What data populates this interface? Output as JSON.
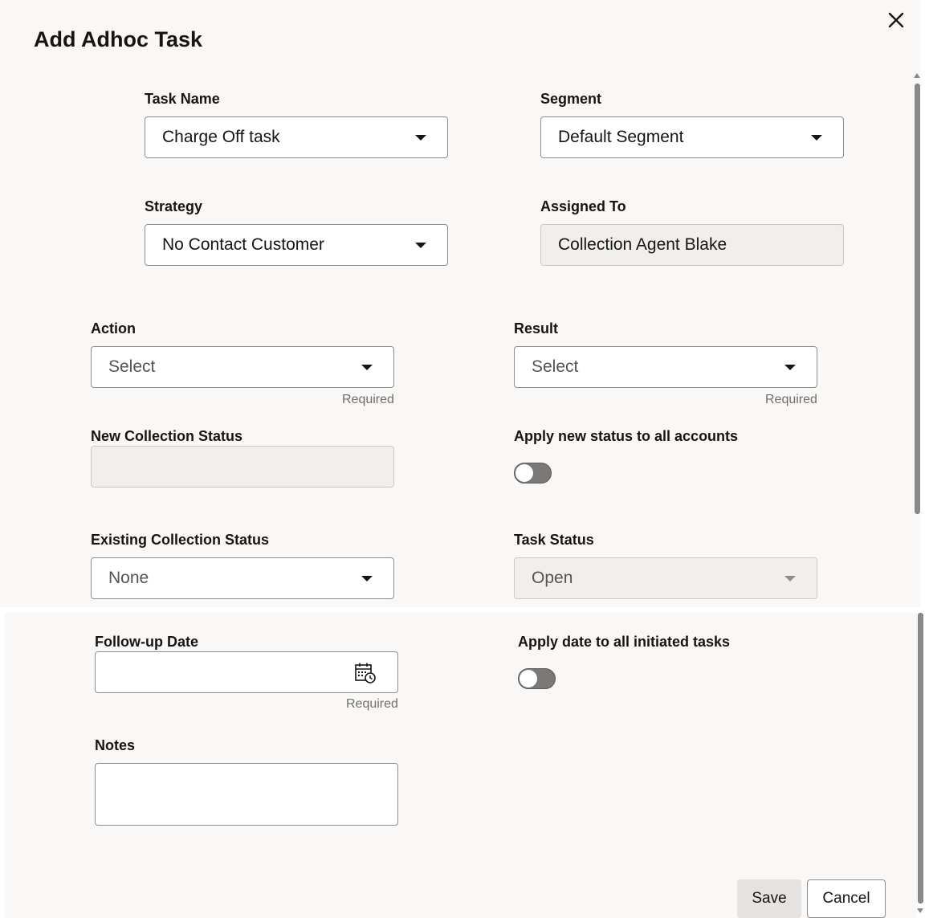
{
  "dialog": {
    "title": "Add Adhoc Task",
    "close_icon": "close-icon"
  },
  "fields": {
    "task_name": {
      "label": "Task Name",
      "value": "Charge Off task"
    },
    "segment": {
      "label": "Segment",
      "value": "Default Segment"
    },
    "strategy": {
      "label": "Strategy",
      "value": "No Contact Customer"
    },
    "assigned_to": {
      "label": "Assigned To",
      "value": "Collection Agent Blake"
    },
    "action": {
      "label": "Action",
      "value": "Select",
      "helper": "Required"
    },
    "result": {
      "label": "Result",
      "value": "Select",
      "helper": "Required"
    },
    "new_collection_status": {
      "label": "New Collection Status",
      "value": ""
    },
    "apply_new_status": {
      "label": "Apply new status to all accounts",
      "checked": false
    },
    "existing_collection_status": {
      "label": "Existing Collection Status",
      "value": "None"
    },
    "task_status": {
      "label": "Task Status",
      "value": "Open"
    },
    "follow_up_date": {
      "label": "Follow-up Date",
      "value": "",
      "helper": "Required",
      "icon": "calendar-icon"
    },
    "apply_date": {
      "label": "Apply date to all initiated tasks",
      "checked": false
    },
    "notes": {
      "label": "Notes",
      "value": ""
    }
  },
  "buttons": {
    "save": "Save",
    "cancel": "Cancel"
  },
  "colors": {
    "background": "#f9f8f6",
    "readonly_fill": "#f0efed",
    "toggle_off": "#7a7977"
  }
}
